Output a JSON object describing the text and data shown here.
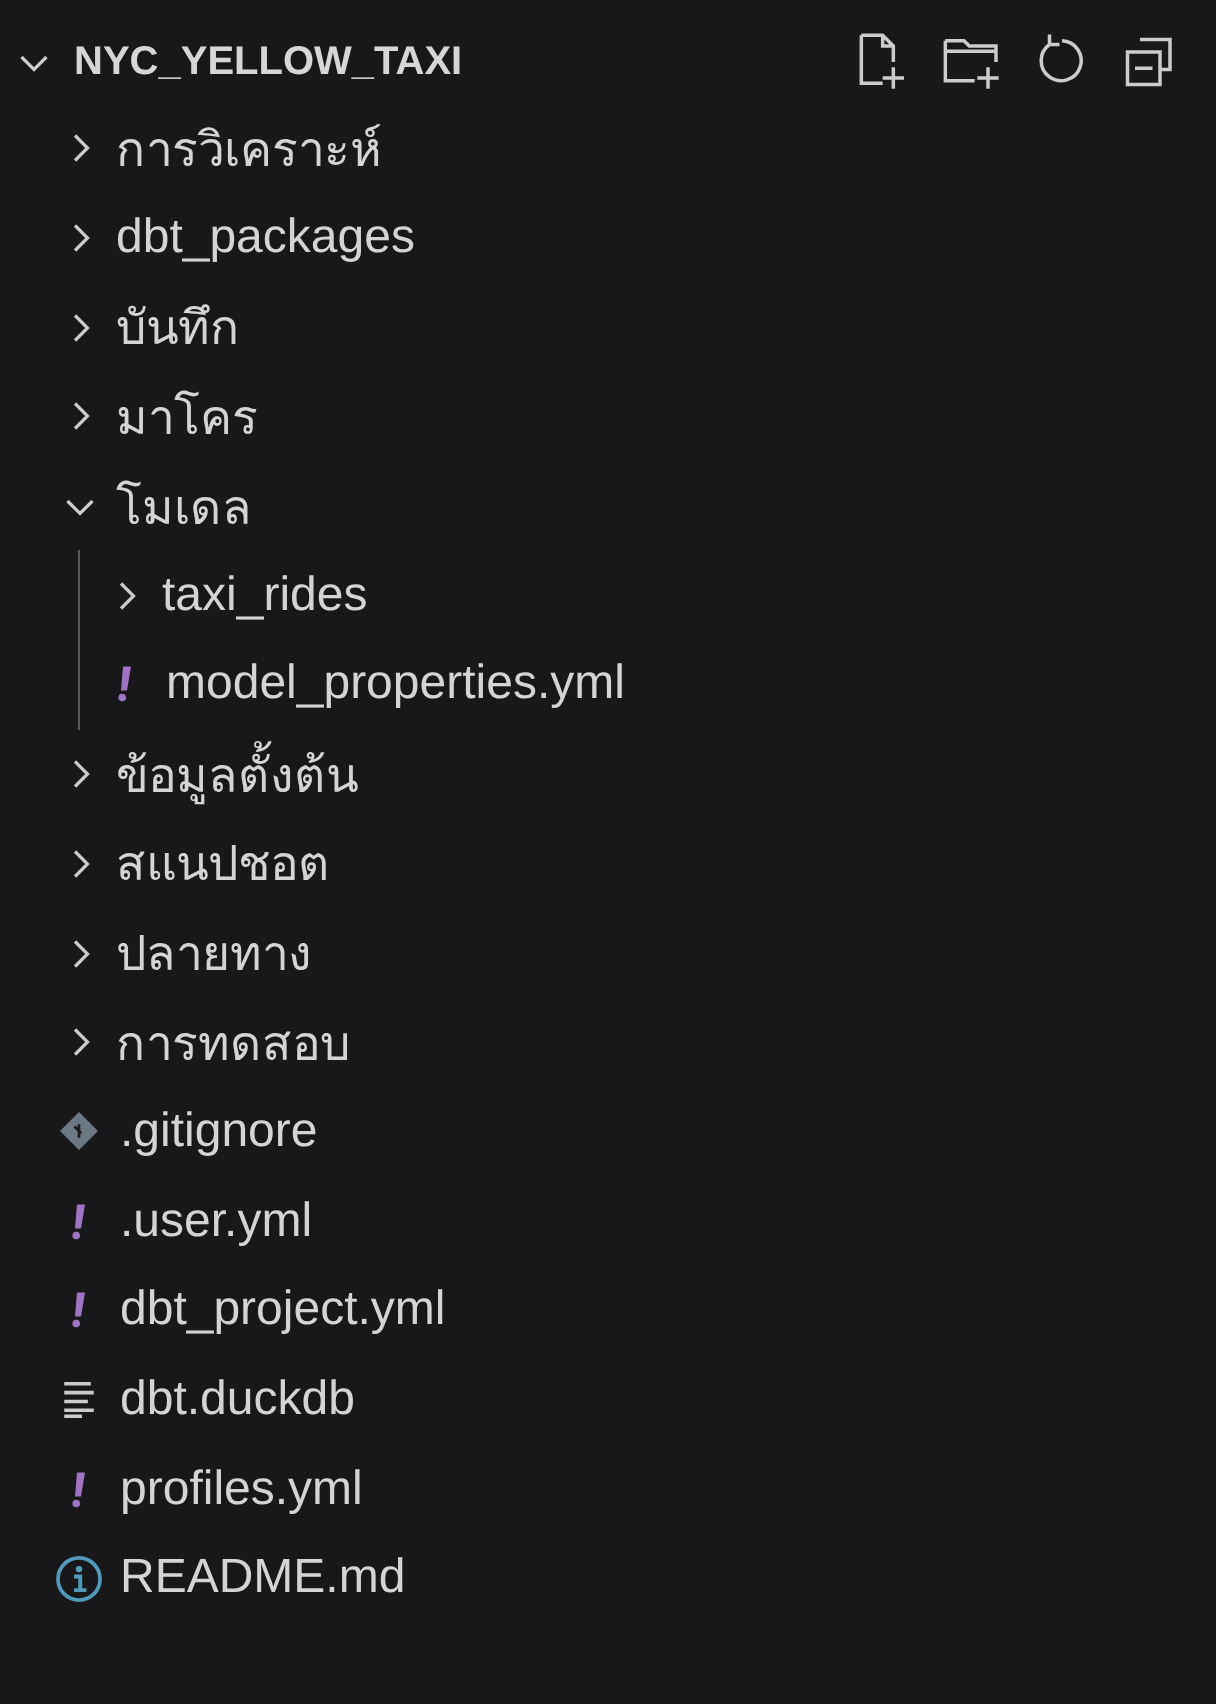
{
  "explorer": {
    "title": "NYC_YELLOW_TAXI",
    "expanded": true,
    "items": [
      {
        "kind": "folder",
        "name": "การวิเคราะห์",
        "expanded": false
      },
      {
        "kind": "folder",
        "name": "dbt_packages",
        "expanded": false
      },
      {
        "kind": "folder",
        "name": "บันทึก",
        "expanded": false
      },
      {
        "kind": "folder",
        "name": "มาโคร",
        "expanded": false
      },
      {
        "kind": "folder",
        "name": "โมเดล",
        "expanded": true,
        "children": [
          {
            "kind": "folder",
            "name": "taxi_rides",
            "expanded": false
          },
          {
            "kind": "yaml",
            "name": "model_properties.yml"
          }
        ]
      },
      {
        "kind": "folder",
        "name": "ข้อมูลตั้งต้น",
        "expanded": false
      },
      {
        "kind": "folder",
        "name": "สแนปชอต",
        "expanded": false
      },
      {
        "kind": "folder",
        "name": "ปลายทาง",
        "expanded": false
      },
      {
        "kind": "folder",
        "name": "การทดสอบ",
        "expanded": false
      },
      {
        "kind": "git",
        "name": ".gitignore"
      },
      {
        "kind": "yaml",
        "name": ".user.yml"
      },
      {
        "kind": "yaml",
        "name": "dbt_project.yml"
      },
      {
        "kind": "text",
        "name": "dbt.duckdb"
      },
      {
        "kind": "yaml",
        "name": "profiles.yml"
      },
      {
        "kind": "info",
        "name": "README.md"
      }
    ]
  }
}
